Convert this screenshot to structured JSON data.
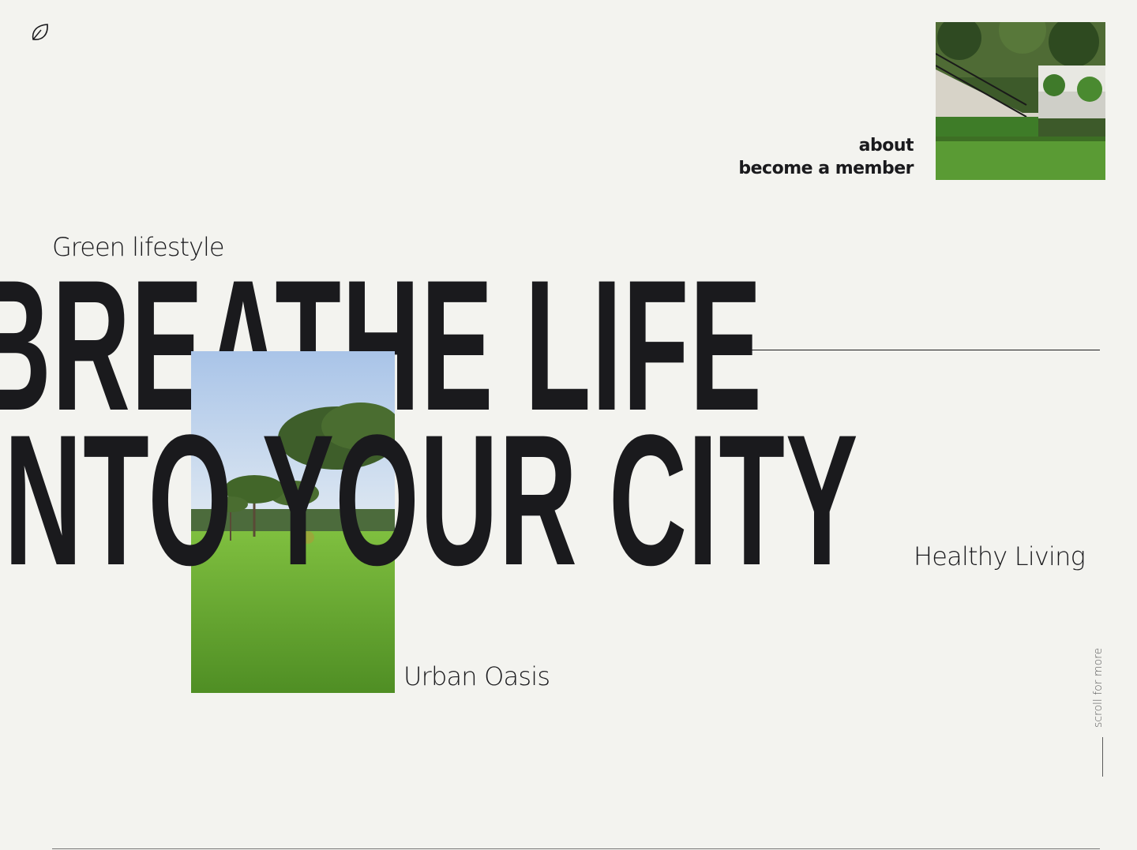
{
  "brand": {
    "logo_icon": "leaf-icon"
  },
  "nav": {
    "items": [
      {
        "label": "about"
      },
      {
        "label": "become a member"
      }
    ]
  },
  "hero": {
    "kicker": "Green lifestyle",
    "headline_line1": "BREATHE LIFE",
    "headline_line2": "INTO YOUR CITY",
    "tag_right": "Healthy Living",
    "tag_bottom": "Urban Oasis"
  },
  "scroll": {
    "label": "scroll for more"
  },
  "colors": {
    "background": "#f3f3ef",
    "text": "#1a1a1d",
    "grass": "#5aa02c"
  }
}
